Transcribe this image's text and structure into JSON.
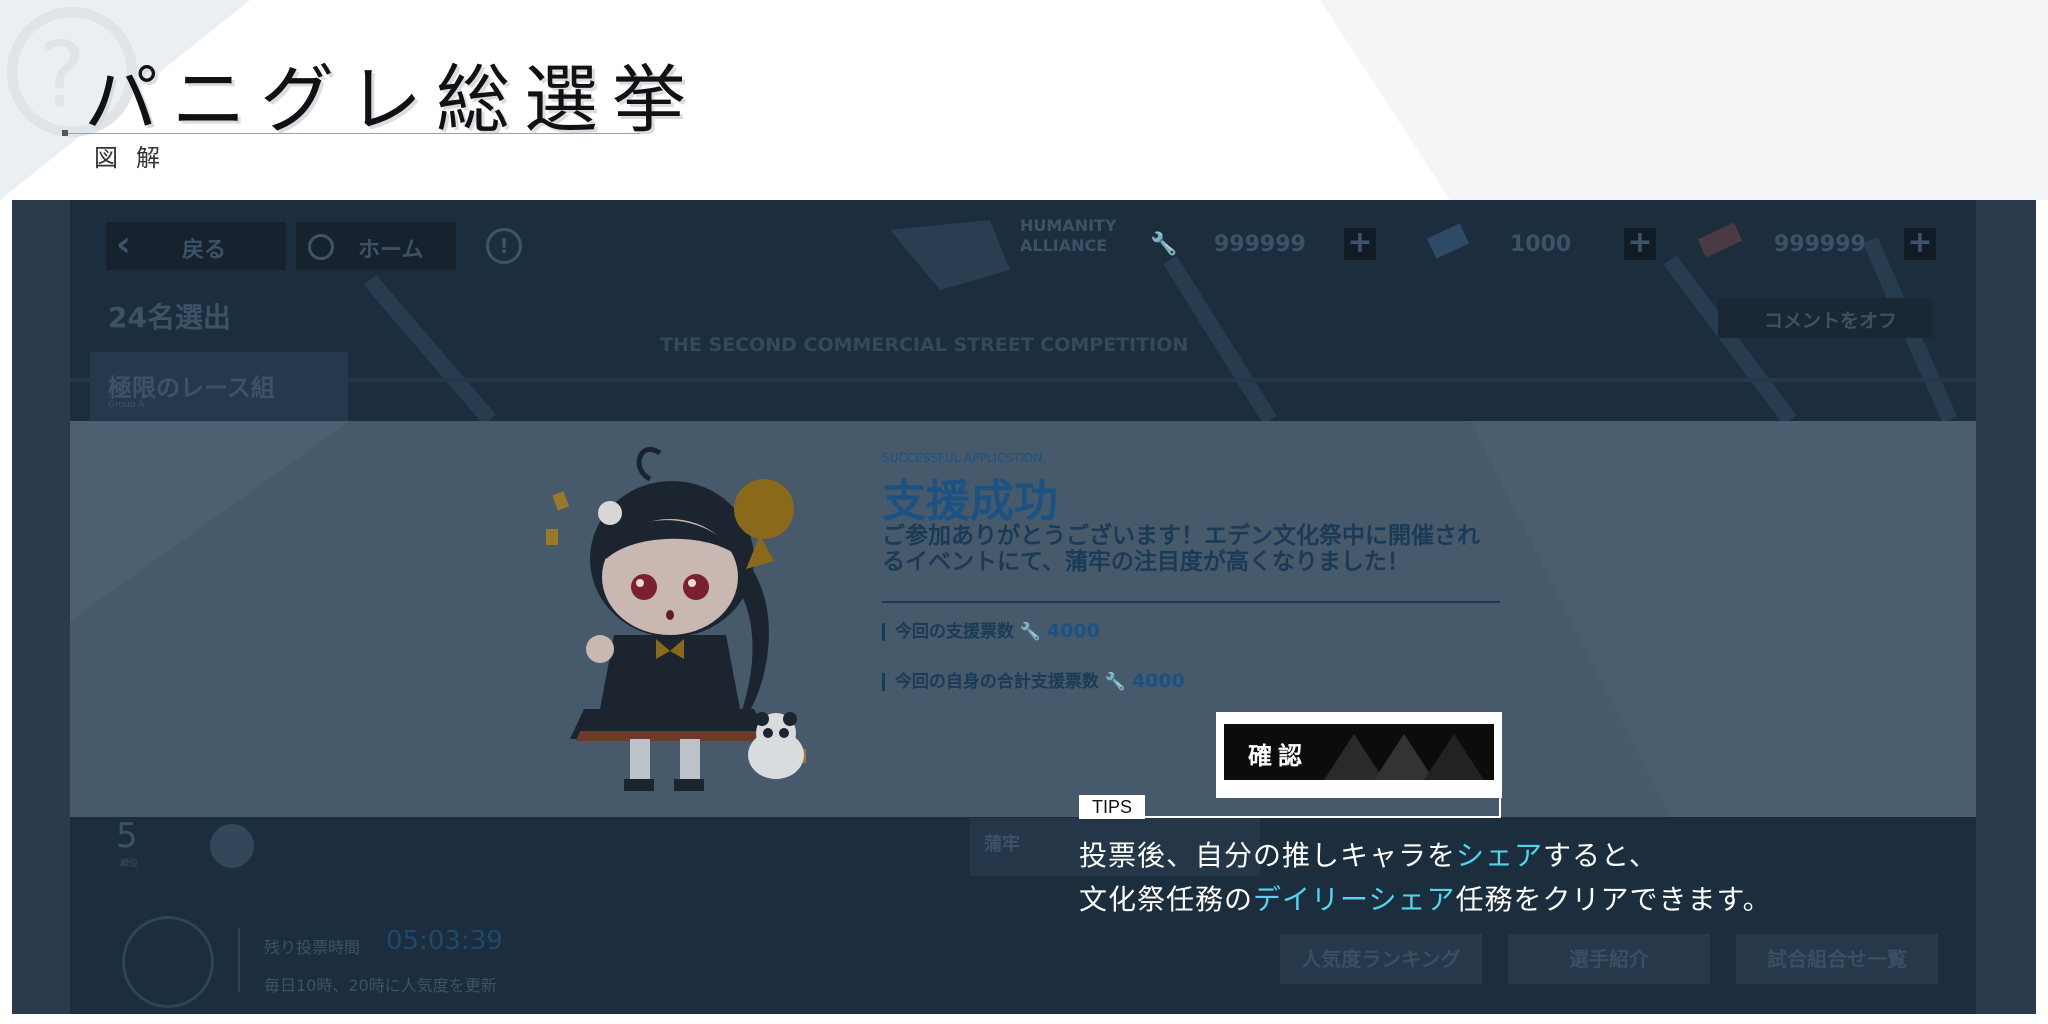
{
  "header": {
    "title": "パニグレ総選挙",
    "subtitle": "図解"
  },
  "game": {
    "topbar": {
      "back_label": "戻る",
      "home_label": "ホーム",
      "info_icon": "exclamation-circle-icon",
      "brand_line1": "HUMANITY",
      "brand_line2": "ALLIANCE",
      "currencies": [
        {
          "icon": "wrench-icon",
          "value": "999999"
        },
        {
          "icon": "eraser-icon",
          "value": "1000"
        },
        {
          "icon": "ticket-icon",
          "value": "999999"
        }
      ]
    },
    "competitors_heading": "24名選出",
    "comment_off_label": "コメントをオフ",
    "competition_subtitle": "THE SECOND COMMERCIAL STREET COMPETITION",
    "group": {
      "label": "極限のレース組",
      "sub": "Group A"
    },
    "rank": {
      "value": "5",
      "label": "順位"
    },
    "vote": {
      "remaining_label": "残り投票時間",
      "remaining_time": "05:03:39",
      "note": "毎日10時、20時に人気度を更新"
    },
    "character_name": "蒲牢",
    "bottom_buttons": [
      "人気度ランキング",
      "選手紹介",
      "試合組合せ一覧"
    ],
    "colors": {
      "accent": "#1b5282",
      "highlight": "#4fd6f0",
      "dim": "#1e2f3f"
    }
  },
  "modal": {
    "small_title": "SUCCESSFUL APPLICSTION",
    "title": "支援成功",
    "message": "ご参加ありがとうございます！エデン文化祭中に開催されるイベントにて、蒲牢の注目度が高くなりました！",
    "row1": {
      "label": "今回の支援票数",
      "icon": "wrench-icon",
      "value": "4000"
    },
    "row2": {
      "label": "今回の自身の合計支援票数",
      "icon": "wrench-icon",
      "value": "4000"
    },
    "confirm_label": "確認"
  },
  "tips": {
    "tag": "TIPS",
    "line1": {
      "a": "投票後、自分の推しキャラを",
      "hl": "シェア",
      "b": "すると、"
    },
    "line2": {
      "a": "文化祭任務の",
      "hl": "デイリーシェア",
      "b": "任務をクリアできます。"
    }
  }
}
